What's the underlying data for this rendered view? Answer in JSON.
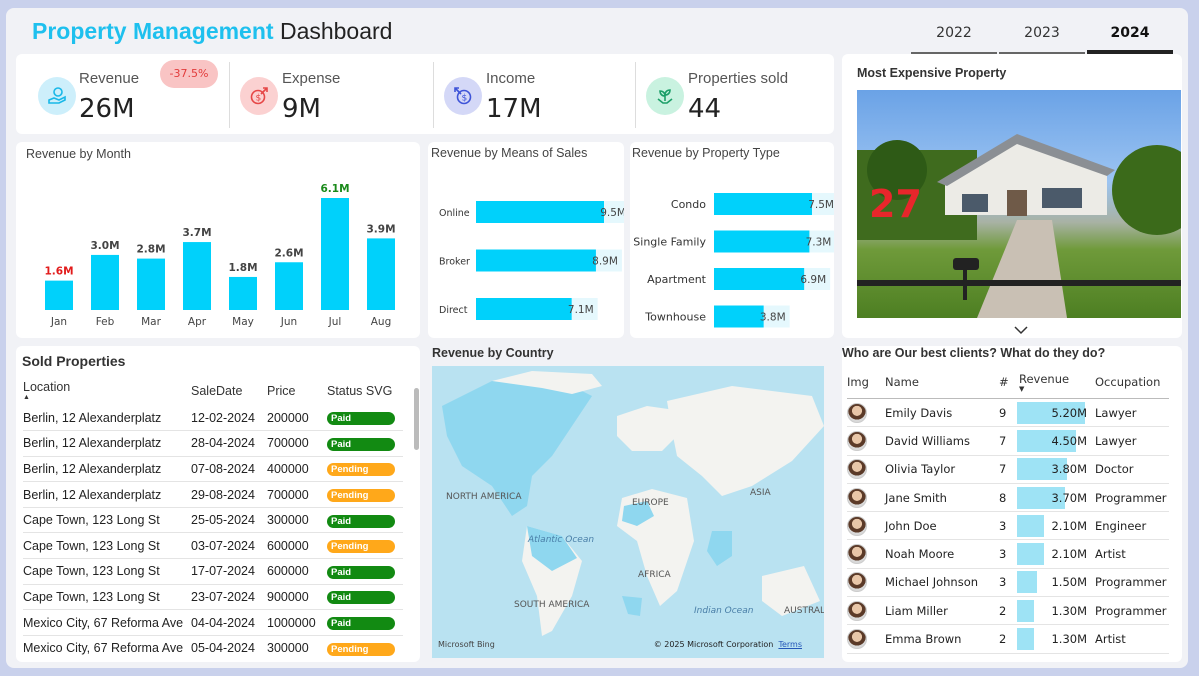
{
  "header": {
    "title_accent": "Property Management",
    "title_rest": " Dashboard",
    "years": [
      "2022",
      "2023",
      "2024"
    ],
    "active_year": "2024"
  },
  "kpis": {
    "badge": "-37.5%",
    "items": [
      {
        "label": "Revenue",
        "value": "26M",
        "icon": "hand-coin-icon"
      },
      {
        "label": "Expense",
        "value": "9M",
        "icon": "coin-arrow-out-icon"
      },
      {
        "label": "Income",
        "value": "17M",
        "icon": "coin-arrow-in-icon"
      },
      {
        "label": "Properties sold",
        "value": "44",
        "icon": "plant-hands-icon"
      }
    ]
  },
  "revenue_by_month": {
    "title": "Revenue by Month",
    "months": [
      "Jan",
      "Feb",
      "Mar",
      "Apr",
      "May",
      "Jun",
      "Jul",
      "Aug"
    ],
    "values": [
      1.6,
      3.0,
      2.8,
      3.7,
      1.8,
      2.6,
      6.1,
      3.9
    ],
    "labels": [
      "1.6M",
      "3.0M",
      "2.8M",
      "3.7M",
      "1.8M",
      "2.6M",
      "6.1M",
      "3.9M"
    ],
    "min_label_color": "#e21b1b",
    "max_label_color": "#1a8a1a"
  },
  "revenue_by_means": {
    "title": "Revenue by Means of Sales",
    "categories": [
      "Online",
      "Broker",
      "Direct"
    ],
    "values": [
      9.5,
      8.9,
      7.1
    ],
    "labels": [
      "9.5M",
      "8.9M",
      "7.1M"
    ]
  },
  "revenue_by_type": {
    "title": "Revenue by Property Type",
    "categories": [
      "Condo",
      "Single Family",
      "Apartment",
      "Townhouse"
    ],
    "values": [
      7.5,
      7.3,
      6.9,
      3.8
    ],
    "labels": [
      "7.5M",
      "7.3M",
      "6.9M",
      "3.8M"
    ]
  },
  "chart_data": [
    {
      "type": "bar",
      "title": "Revenue by Month",
      "categories": [
        "Jan",
        "Feb",
        "Mar",
        "Apr",
        "May",
        "Jun",
        "Jul",
        "Aug"
      ],
      "values": [
        1.6,
        3.0,
        2.8,
        3.7,
        1.8,
        2.6,
        6.1,
        3.9
      ]
    },
    {
      "type": "bar",
      "title": "Revenue by Means of Sales",
      "categories": [
        "Online",
        "Broker",
        "Direct"
      ],
      "values": [
        9.5,
        8.9,
        7.1
      ]
    },
    {
      "type": "bar",
      "title": "Revenue by Property Type",
      "categories": [
        "Condo",
        "Single Family",
        "Apartment",
        "Townhouse"
      ],
      "values": [
        7.5,
        7.3,
        6.9,
        3.8
      ]
    }
  ],
  "expensive": {
    "title": "Most Expensive Property",
    "overlay_number": "27"
  },
  "sold": {
    "title": "Sold Properties",
    "columns": [
      "Location",
      "SaleDate",
      "Price",
      "Status SVG"
    ],
    "rows": [
      {
        "location": "Berlin, 12 Alexanderplatz",
        "date": "12-02-2024",
        "price": "200000",
        "status": "Paid"
      },
      {
        "location": "Berlin, 12 Alexanderplatz",
        "date": "28-04-2024",
        "price": "700000",
        "status": "Paid"
      },
      {
        "location": "Berlin, 12 Alexanderplatz",
        "date": "07-08-2024",
        "price": "400000",
        "status": "Pending"
      },
      {
        "location": "Berlin, 12 Alexanderplatz",
        "date": "29-08-2024",
        "price": "700000",
        "status": "Pending"
      },
      {
        "location": "Cape Town, 123 Long St",
        "date": "25-05-2024",
        "price": "300000",
        "status": "Paid"
      },
      {
        "location": "Cape Town, 123 Long St",
        "date": "03-07-2024",
        "price": "600000",
        "status": "Pending"
      },
      {
        "location": "Cape Town, 123 Long St",
        "date": "17-07-2024",
        "price": "600000",
        "status": "Paid"
      },
      {
        "location": "Cape Town, 123 Long St",
        "date": "23-07-2024",
        "price": "900000",
        "status": "Paid"
      },
      {
        "location": "Mexico City, 67 Reforma Ave",
        "date": "04-04-2024",
        "price": "1000000",
        "status": "Paid"
      },
      {
        "location": "Mexico City, 67 Reforma Ave",
        "date": "05-04-2024",
        "price": "300000",
        "status": "Pending"
      }
    ],
    "paid_color": "#128a12",
    "pending_color": "#ffa81a"
  },
  "map": {
    "title": "Revenue by Country",
    "labels": [
      "NORTH AMERICA",
      "EUROPE",
      "ASIA",
      "AFRICA",
      "SOUTH AMERICA",
      "AUSTRAL"
    ],
    "oceans": [
      "Atlantic Ocean",
      "Indian Ocean"
    ],
    "bing": "Microsoft Bing",
    "copyright": "© 2025 Microsoft Corporation",
    "terms": "Terms"
  },
  "clients": {
    "title": "Who are Our best clients? What do they do?",
    "columns": [
      "Img",
      "Name",
      "#",
      "Revenue",
      "Occupation"
    ],
    "rows": [
      {
        "name": "Emily Davis",
        "count": "9",
        "revenue": "5.20M",
        "rev": 5.2,
        "occupation": "Lawyer"
      },
      {
        "name": "David Williams",
        "count": "7",
        "revenue": "4.50M",
        "rev": 4.5,
        "occupation": "Lawyer"
      },
      {
        "name": "Olivia Taylor",
        "count": "7",
        "revenue": "3.80M",
        "rev": 3.8,
        "occupation": "Doctor"
      },
      {
        "name": "Jane Smith",
        "count": "8",
        "revenue": "3.70M",
        "rev": 3.7,
        "occupation": "Programmer"
      },
      {
        "name": "John Doe",
        "count": "3",
        "revenue": "2.10M",
        "rev": 2.1,
        "occupation": "Engineer"
      },
      {
        "name": "Noah Moore",
        "count": "3",
        "revenue": "2.10M",
        "rev": 2.1,
        "occupation": "Artist"
      },
      {
        "name": "Michael Johnson",
        "count": "3",
        "revenue": "1.50M",
        "rev": 1.5,
        "occupation": "Programmer"
      },
      {
        "name": "Liam Miller",
        "count": "2",
        "revenue": "1.30M",
        "rev": 1.3,
        "occupation": "Programmer"
      },
      {
        "name": "Emma Brown",
        "count": "2",
        "revenue": "1.30M",
        "rev": 1.3,
        "occupation": "Artist"
      }
    ]
  }
}
